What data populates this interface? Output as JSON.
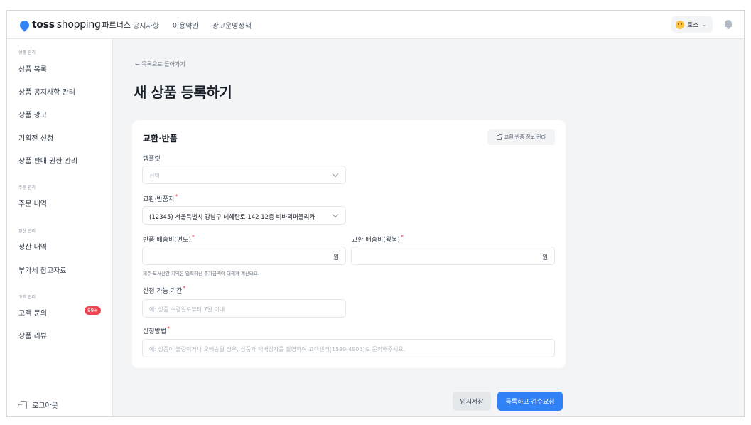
{
  "header": {
    "brand_main": "toss",
    "brand_sub": "shopping",
    "brand_tail": "파트너스",
    "nav": [
      "공지사항",
      "이용약관",
      "광고운영정책"
    ],
    "user_name": "토스",
    "user_chevron": "⌄"
  },
  "sidebar": {
    "sections": {
      "product": "상품 관리",
      "order": "주문 관리",
      "settlement": "정산 관리",
      "customer": "고객 관리"
    },
    "items": {
      "product_list": "상품 목록",
      "product_notice": "상품 공지사항 관리",
      "product_ad": "상품 광고",
      "exhibition": "기획전 신청",
      "sales_permission": "상품 판매 권한 관리",
      "order_history": "주문 내역",
      "settlement_history": "정산 내역",
      "vat_reference": "부가세 참고자료",
      "customer_inquiry": "고객 문의",
      "product_review": "상품 리뷰"
    },
    "inquiry_badge": "99+",
    "logout": "로그아웃"
  },
  "main": {
    "back_link": "← 목록으로 돌아가기",
    "page_title": "새 상품 등록하기",
    "card": {
      "title": "교환·반품",
      "manage_button": "교환·반품 정보 관리",
      "template_label": "템플릿",
      "template_placeholder": "선택",
      "address_label": "교환·반품지",
      "address_value": "(12345) 서울특별시 강남구 테헤란로 142 12층 비바리퍼블리카",
      "return_fee_label": "반품 배송비(편도)",
      "exchange_fee_label": "교환 배송비(왕복)",
      "currency_unit": "원",
      "fee_hint": "제주·도서산간 지역은 입력하신 추가금액이 더해져 계산돼요.",
      "period_label": "신청 가능 기간",
      "period_placeholder": "예: 상품 수령일로부터 7일 이내",
      "method_label": "신청방법",
      "method_placeholder": "예: 상품이 불량이거나 오배송일 경우, 상품과 택배상자를 촬영하여 고객센터(1599-4905)로 문의해주세요.",
      "required_mark": "*"
    },
    "buttons": {
      "save_draft": "임시저장",
      "submit": "등록하고 검수요청"
    }
  },
  "colors": {
    "accent": "#3182f6",
    "badge": "#f04452",
    "background": "#f2f4f6"
  }
}
